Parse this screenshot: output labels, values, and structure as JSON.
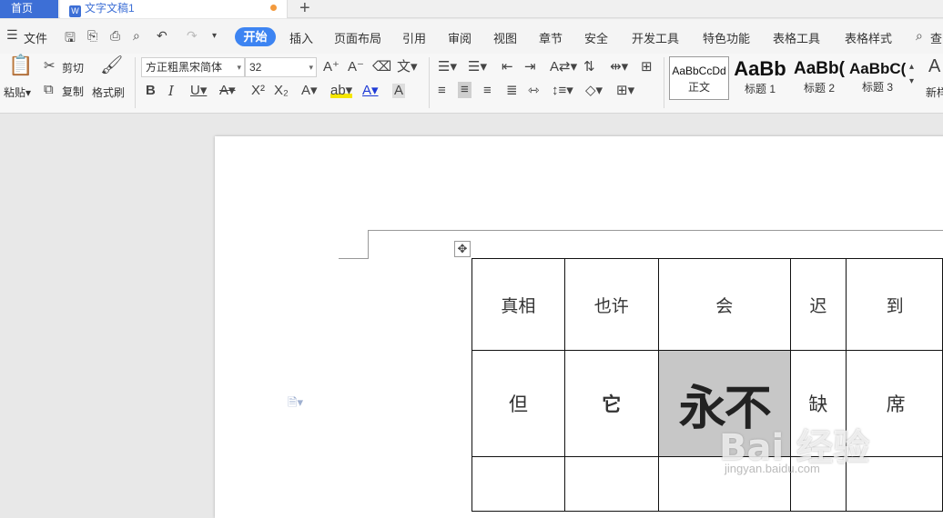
{
  "tabs": {
    "home": "首页",
    "document": "文字文稿1",
    "new_tab": "+"
  },
  "menu": {
    "file": "文件",
    "items": [
      "开始",
      "插入",
      "页面布局",
      "引用",
      "审阅",
      "视图",
      "章节",
      "安全",
      "开发工具",
      "特色功能",
      "表格工具",
      "表格样式",
      "查"
    ]
  },
  "ribbon": {
    "paste": "粘贴",
    "cut": "剪切",
    "copy": "复制",
    "format_painter": "格式刷",
    "font_name": "方正粗黑宋简体",
    "font_size": "32",
    "styles": [
      {
        "sample": "AaBbCcDd",
        "name": "正文"
      },
      {
        "sample": "AaBb",
        "name": "标题 1"
      },
      {
        "sample": "AaBb(",
        "name": "标题 2"
      },
      {
        "sample": "AaBbC(",
        "name": "标题 3"
      }
    ],
    "more": "新样"
  },
  "table": {
    "row1": [
      "真相",
      "也许",
      "会",
      "迟",
      "到"
    ],
    "row2": [
      "但",
      "它",
      "永不",
      "缺",
      "席"
    ]
  },
  "watermark": {
    "logo": "Bai 经验",
    "url": "jingyan.baidu.com"
  }
}
